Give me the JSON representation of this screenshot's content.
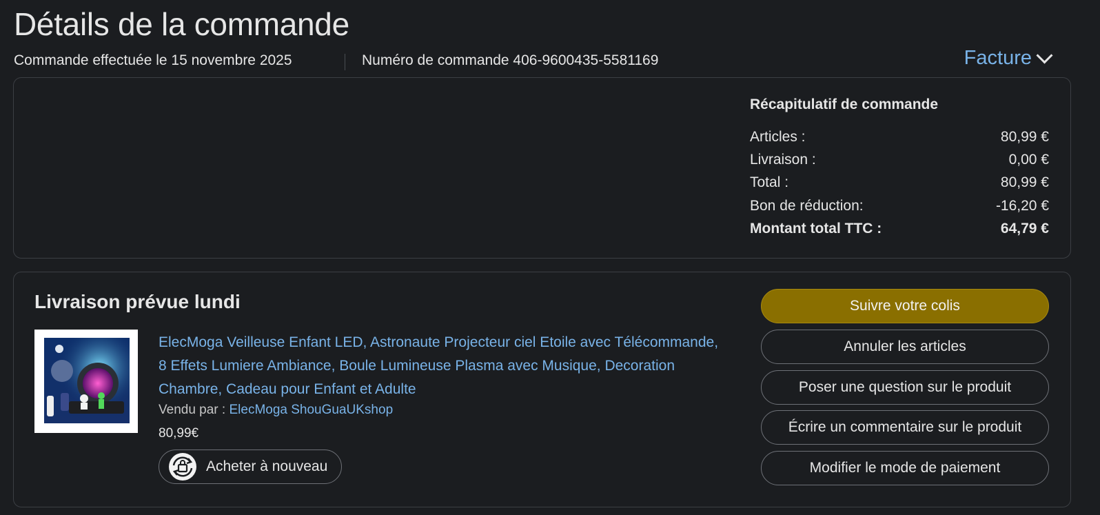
{
  "page": {
    "title": "Détails de la commande",
    "order_date": "Commande effectuée le 15 novembre 2025",
    "order_number": "Numéro de commande 406-9600435-5581169",
    "invoice_label": "Facture"
  },
  "summary": {
    "title": "Récapitulatif de commande",
    "rows": [
      {
        "label": "Articles :",
        "value": "80,99 €"
      },
      {
        "label": "Livraison :",
        "value": "0,00 €"
      },
      {
        "label": "Total :",
        "value": "80,99 €"
      },
      {
        "label": "Bon de réduction:",
        "value": "-16,20 €"
      },
      {
        "label": "Montant total TTC :",
        "value": "64,79 €"
      }
    ]
  },
  "delivery": {
    "title": "Livraison prévue lundi",
    "product_title": "ElecMoga Veilleuse Enfant LED, Astronaute Projecteur ciel Etoile avec Télécommande, 8 Effets Lumiere Ambiance, Boule Lumineuse Plasma avec Musique, Decoration Chambre, Cadeau pour Enfant et Adulte",
    "sold_by_label": "Vendu par  :",
    "seller": "ElecMoga ShouGuaUKshop",
    "price": "80,99€",
    "rebuy_label": "Acheter à nouveau"
  },
  "actions": {
    "track": "Suivre votre colis",
    "cancel": "Annuler les articles",
    "question": "Poser une question sur le produit",
    "review": "Écrire un commentaire sur le produit",
    "payment": "Modifier le mode de paiement"
  },
  "colors": {
    "background": "#1b1d20",
    "link": "#79b3e8",
    "primary_button": "#8a6f00"
  }
}
